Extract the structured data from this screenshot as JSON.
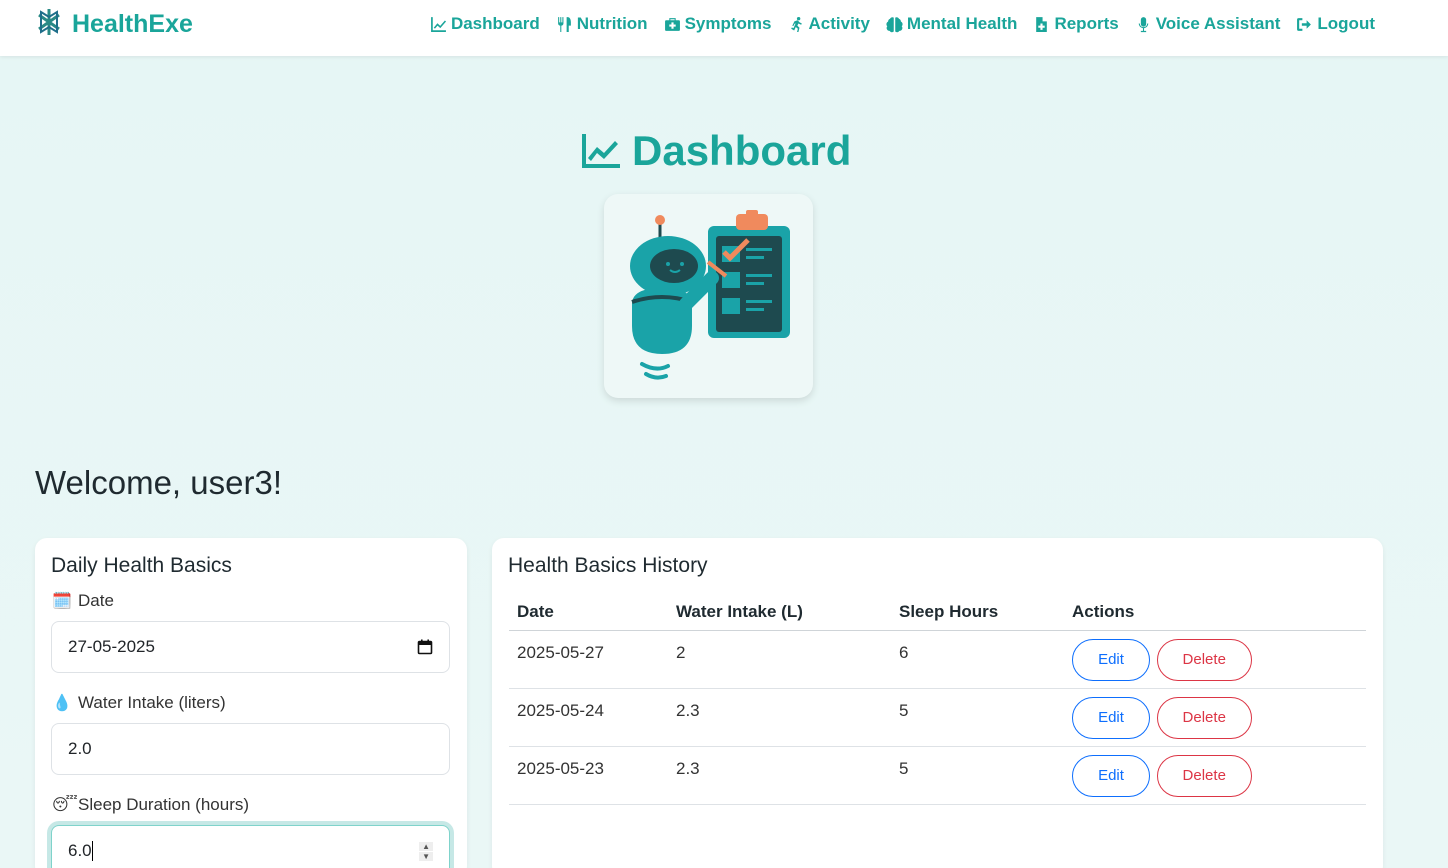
{
  "brand": {
    "name": "HealthExe"
  },
  "nav": {
    "items": [
      {
        "label": "Dashboard",
        "icon": "chart-line-icon"
      },
      {
        "label": "Nutrition",
        "icon": "utensils-icon"
      },
      {
        "label": "Symptoms",
        "icon": "medkit-icon"
      },
      {
        "label": "Activity",
        "icon": "running-icon"
      },
      {
        "label": "Mental Health",
        "icon": "brain-icon"
      },
      {
        "label": "Reports",
        "icon": "file-medical-icon"
      },
      {
        "label": "Voice Assistant",
        "icon": "microphone-icon"
      },
      {
        "label": "Logout",
        "icon": "sign-out-icon"
      }
    ]
  },
  "page": {
    "title": "Dashboard",
    "welcome": "Welcome, user3!"
  },
  "form": {
    "title": "Daily Health Basics",
    "date_label": "Date",
    "date_value": "27-05-2025",
    "water_label": "Water Intake (liters)",
    "water_value": "2.0",
    "sleep_label": "Sleep Duration (hours)",
    "sleep_value": "6.0",
    "emoji_calendar": "🗓️",
    "emoji_water": "💧",
    "emoji_sleep": "😴"
  },
  "history": {
    "title": "Health Basics History",
    "columns": [
      "Date",
      "Water Intake (L)",
      "Sleep Hours",
      "Actions"
    ],
    "rows": [
      {
        "date": "2025-05-27",
        "water": "2",
        "sleep": "6"
      },
      {
        "date": "2025-05-24",
        "water": "2.3",
        "sleep": "5"
      },
      {
        "date": "2025-05-23",
        "water": "2.3",
        "sleep": "5"
      }
    ],
    "edit_label": "Edit",
    "delete_label": "Delete"
  },
  "colors": {
    "accent": "#1aa59a",
    "edit": "#0d6efd",
    "delete": "#dc3545"
  }
}
